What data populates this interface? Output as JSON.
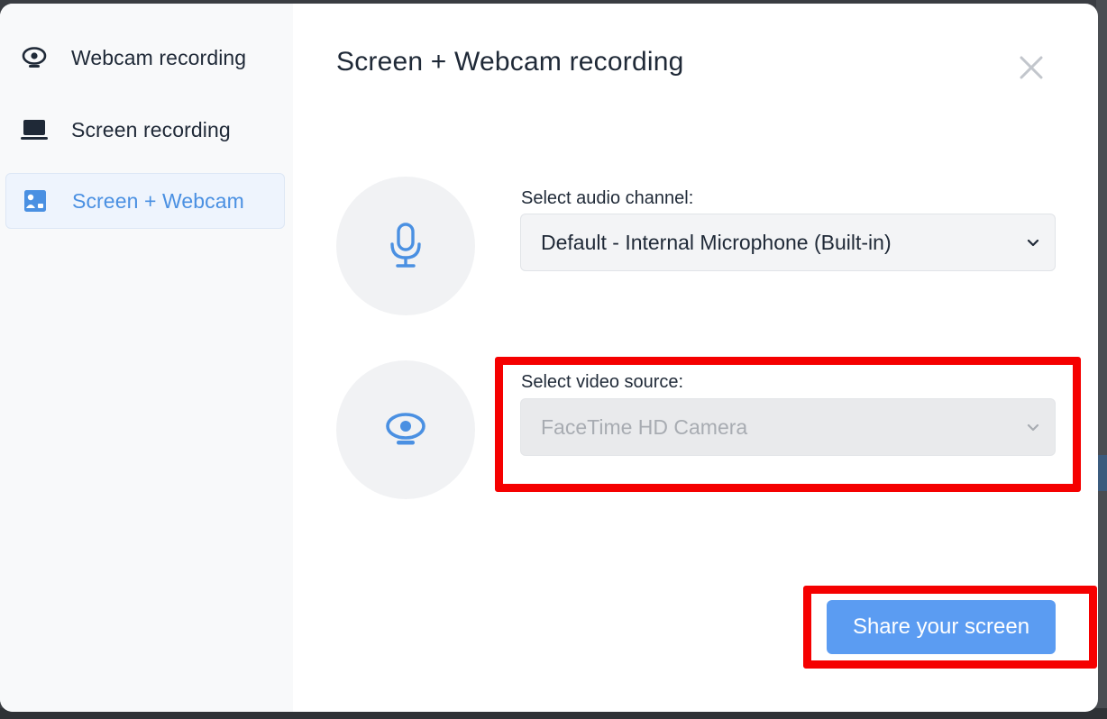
{
  "sidebar": {
    "items": [
      {
        "label": "Webcam recording",
        "icon": "webcam-icon",
        "active": false
      },
      {
        "label": "Screen recording",
        "icon": "laptop-icon",
        "active": false
      },
      {
        "label": "Screen + Webcam",
        "icon": "screen-webcam-icon",
        "active": true
      }
    ]
  },
  "dialog": {
    "title": "Screen + Webcam recording",
    "close_icon": "close-icon"
  },
  "audio": {
    "label": "Select audio channel:",
    "value": "Default - Internal Microphone (Built-in)",
    "icon": "microphone-icon"
  },
  "video": {
    "label": "Select video source:",
    "value": "FaceTime HD Camera",
    "icon": "webcam-icon",
    "disabled": true
  },
  "actions": {
    "share_label": "Share your screen"
  },
  "colors": {
    "accent": "#5b9cf2",
    "active_text": "#4a90e2",
    "highlight": "#f50000"
  }
}
